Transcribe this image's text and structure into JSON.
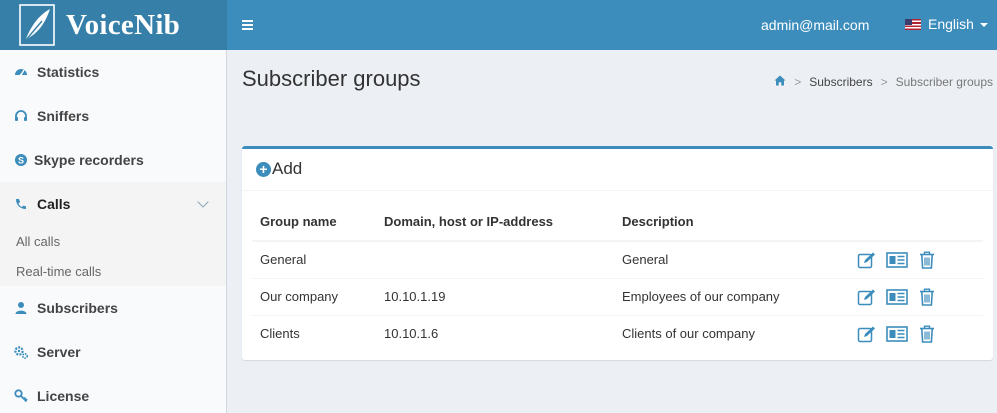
{
  "header": {
    "brand": "VoiceNib",
    "user_email": "admin@mail.com",
    "language": "English"
  },
  "sidebar": {
    "items": [
      {
        "label": "Statistics",
        "icon": "dashboard-icon"
      },
      {
        "label": "Sniffers",
        "icon": "headphones-icon"
      },
      {
        "label": "Skype recorders",
        "icon": "skype-icon"
      },
      {
        "label": "Calls",
        "icon": "phone-icon"
      },
      {
        "label": "Subscribers",
        "icon": "user-icon"
      },
      {
        "label": "Server",
        "icon": "cogs-icon"
      },
      {
        "label": "License",
        "icon": "key-icon"
      }
    ],
    "calls_submenu": [
      "All calls",
      "Real-time calls"
    ]
  },
  "page": {
    "title": "Subscriber groups",
    "breadcrumb": [
      "Subscribers",
      "Subscriber groups"
    ]
  },
  "box": {
    "add_label": "Add"
  },
  "table": {
    "headers": [
      "Group name",
      "Domain, host or IP-address",
      "Description"
    ],
    "rows": [
      {
        "name": "General",
        "domain": "",
        "description": "General"
      },
      {
        "name": "Our company",
        "domain": "10.10.1.19",
        "description": "Employees of our company"
      },
      {
        "name": "Clients",
        "domain": "10.10.1.6",
        "description": "Clients of our company"
      }
    ]
  },
  "colors": {
    "header": "#3c8dbc",
    "logo_bg": "#367fa9",
    "accent": "#3c8dbc",
    "sidebar_bg": "#f9fafc",
    "content_bg": "#ecf0f5"
  }
}
